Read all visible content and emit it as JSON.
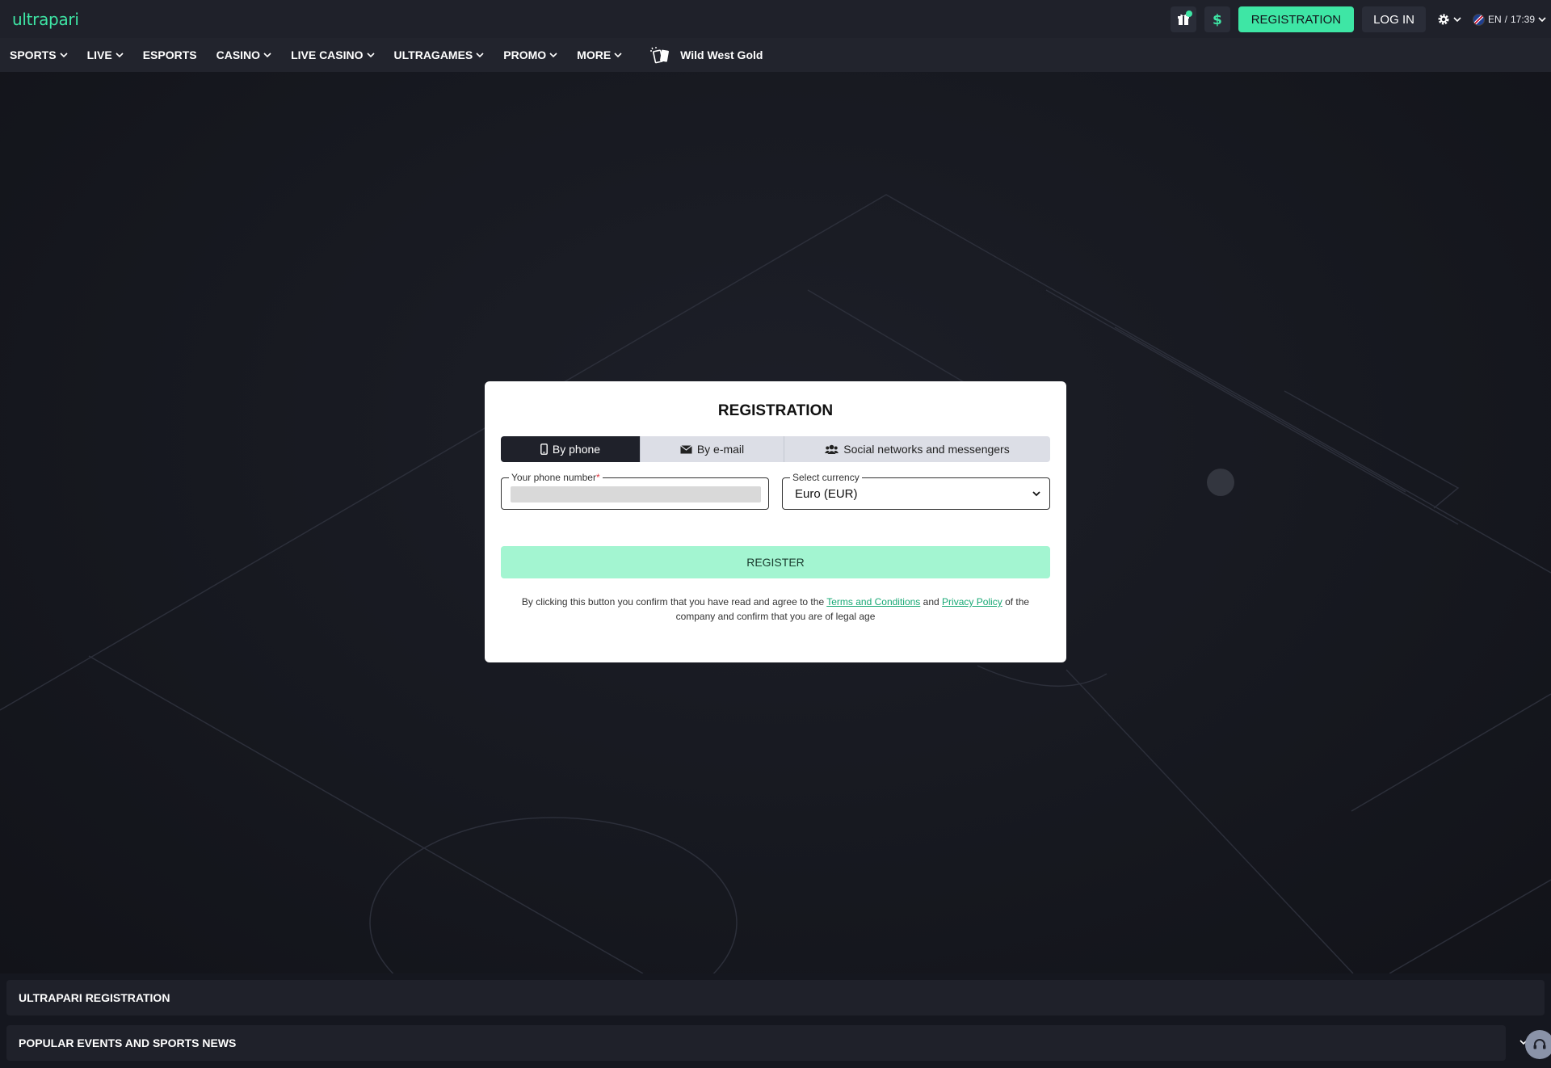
{
  "topbar": {
    "logo": "ultrapari",
    "registration_label": "REGISTRATION",
    "login_label": "LOG IN",
    "language": "EN",
    "separator": "/",
    "time": "17:39"
  },
  "nav": {
    "items": [
      {
        "label": "SPORTS",
        "dropdown": true
      },
      {
        "label": "LIVE",
        "dropdown": true
      },
      {
        "label": "ESPORTS",
        "dropdown": false
      },
      {
        "label": "CASINO",
        "dropdown": true
      },
      {
        "label": "LIVE CASINO",
        "dropdown": true
      },
      {
        "label": "ULTRAGAMES",
        "dropdown": true
      },
      {
        "label": "PROMO",
        "dropdown": true
      },
      {
        "label": "MORE",
        "dropdown": true
      }
    ],
    "featured_game": "Wild West Gold"
  },
  "modal": {
    "title": "REGISTRATION",
    "tabs": [
      {
        "label": "By phone",
        "icon": "phone-icon",
        "active": true
      },
      {
        "label": "By e-mail",
        "icon": "envelope-icon",
        "active": false
      },
      {
        "label": "Social networks and messengers",
        "icon": "users-icon",
        "active": false
      }
    ],
    "phone_label": "Your phone number",
    "required_mark": "*",
    "currency_label": "Select currency",
    "currency_value": "Euro (EUR)",
    "register_label": "REGISTER",
    "disclaimer": {
      "part1": "By clicking this button you confirm that you have read and agree to the",
      "terms_link": "Terms and Conditions",
      "and": "and",
      "privacy_link": "Privacy Policy",
      "part2": "of the company and confirm that you are of legal age"
    }
  },
  "sections": {
    "registration": "ULTRAPARI REGISTRATION",
    "popular": "POPULAR EVENTS AND SPORTS NEWS"
  },
  "colors": {
    "accent": "#3ee6a5",
    "topbar_bg": "#1f212a",
    "nav_bg": "#22242d",
    "page_bg": "#15171f",
    "register_disabled": "#a3f5d1"
  }
}
